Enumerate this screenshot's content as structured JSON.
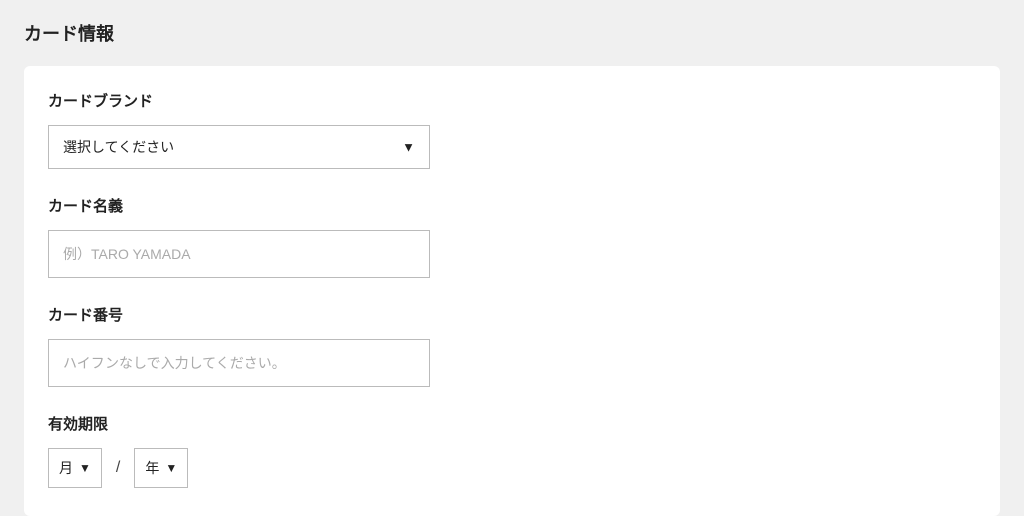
{
  "section": {
    "title": "カード情報"
  },
  "card_brand": {
    "label": "カードブランド",
    "selected": "選択してください"
  },
  "card_name": {
    "label": "カード名義",
    "placeholder": "例）TARO YAMADA"
  },
  "card_number": {
    "label": "カード番号",
    "placeholder": "ハイフンなしで入力してください。"
  },
  "expiry": {
    "label": "有効期限",
    "month_label": "月",
    "year_label": "年",
    "separator": "/"
  }
}
